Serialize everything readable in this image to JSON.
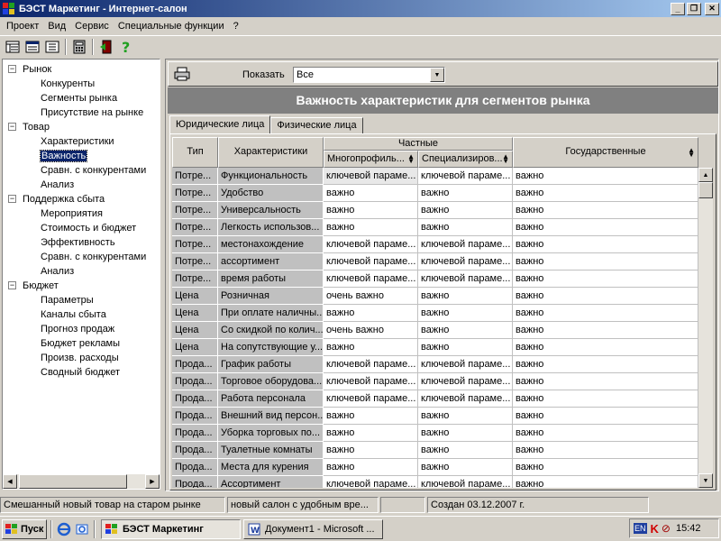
{
  "window": {
    "title": "БЭСТ Маркетинг - Интернет-салон"
  },
  "menu": [
    "Проект",
    "Вид",
    "Сервис",
    "Специальные функции",
    "?"
  ],
  "tree": [
    {
      "label": "Рынок",
      "level": 0
    },
    {
      "label": "Конкуренты",
      "level": 1
    },
    {
      "label": "Сегменты рынка",
      "level": 1
    },
    {
      "label": "Присутствие на рынке",
      "level": 1
    },
    {
      "label": "Товар",
      "level": 0
    },
    {
      "label": "Характеристики",
      "level": 1
    },
    {
      "label": "Важность",
      "level": 1,
      "selected": true
    },
    {
      "label": "Сравн. с конкурентами",
      "level": 1
    },
    {
      "label": "Анализ",
      "level": 1
    },
    {
      "label": "Поддержка сбыта",
      "level": 0
    },
    {
      "label": "Мероприятия",
      "level": 1
    },
    {
      "label": "Стоимость и бюджет",
      "level": 1
    },
    {
      "label": "Эффективность",
      "level": 1
    },
    {
      "label": "Сравн. с конкурентами",
      "level": 1
    },
    {
      "label": "Анализ",
      "level": 1
    },
    {
      "label": "Бюджет",
      "level": 0
    },
    {
      "label": "Параметры",
      "level": 1
    },
    {
      "label": "Каналы сбыта",
      "level": 1
    },
    {
      "label": "Прогноз продаж",
      "level": 1
    },
    {
      "label": "Бюджет рекламы",
      "level": 1
    },
    {
      "label": "Произв. расходы",
      "level": 1
    },
    {
      "label": "Сводный бюджет",
      "level": 1
    }
  ],
  "filter": {
    "label": "Показать",
    "value": "Все"
  },
  "banner": "Важность характеристик для сегментов рынка",
  "tabs": [
    "Юридические лица",
    "Физические лица"
  ],
  "grid": {
    "headers": {
      "type": "Тип",
      "characteristic": "Характеристики",
      "private_group": "Частные",
      "multi": "Многопрофиль...",
      "special": "Специализиров...",
      "state": "Государственные"
    },
    "rows": [
      [
        "Потре...",
        "Функциональность",
        "ключевой параме...",
        "ключевой параме...",
        "важно"
      ],
      [
        "Потре...",
        "Удобство",
        "важно",
        "важно",
        "важно"
      ],
      [
        "Потре...",
        "Универсальность",
        "важно",
        "важно",
        "важно"
      ],
      [
        "Потре...",
        "Легкость использов...",
        "важно",
        "важно",
        "важно"
      ],
      [
        "Потре...",
        "местонахождение",
        "ключевой параме...",
        "ключевой параме...",
        "важно"
      ],
      [
        "Потре...",
        "ассортимент",
        "ключевой параме...",
        "ключевой параме...",
        "важно"
      ],
      [
        "Потре...",
        "время работы",
        "ключевой параме...",
        "ключевой параме...",
        "важно"
      ],
      [
        "Цена",
        "Розничная",
        "очень важно",
        "важно",
        "важно"
      ],
      [
        "Цена",
        "При оплате наличны...",
        "важно",
        "важно",
        "важно"
      ],
      [
        "Цена",
        "Со скидкой по колич...",
        "очень важно",
        "важно",
        "важно"
      ],
      [
        "Цена",
        "На сопутствующие у...",
        "важно",
        "важно",
        "важно"
      ],
      [
        "Прода...",
        "График работы",
        "ключевой параме...",
        "ключевой параме...",
        "важно"
      ],
      [
        "Прода...",
        "Торговое оборудова...",
        "ключевой параме...",
        "ключевой параме...",
        "важно"
      ],
      [
        "Прода...",
        "Работа персонала",
        "ключевой параме...",
        "ключевой параме...",
        "важно"
      ],
      [
        "Прода...",
        "Внешний вид персон...",
        "важно",
        "важно",
        "важно"
      ],
      [
        "Прода...",
        "Уборка торговых по...",
        "важно",
        "важно",
        "важно"
      ],
      [
        "Прода...",
        "Туалетные комнаты",
        "важно",
        "важно",
        "важно"
      ],
      [
        "Прода...",
        "Места для курения",
        "важно",
        "важно",
        "важно"
      ],
      [
        "Прода...",
        "Ассортимент",
        "ключевой параме...",
        "ключевой параме...",
        "важно"
      ]
    ]
  },
  "status": [
    "Смешанный новый товар на старом рынке",
    "новый салон с удобным вре...",
    "",
    "Создан 03.12.2007 г."
  ],
  "taskbar": {
    "start": "Пуск",
    "tasks": [
      "БЭСТ Маркетинг",
      "Документ1 - Microsoft ..."
    ],
    "lang": "EN",
    "clock": "15:42"
  },
  "colors": {
    "titlebar": "#0a246a",
    "selection": "#0a246a",
    "banner": "#808080"
  }
}
